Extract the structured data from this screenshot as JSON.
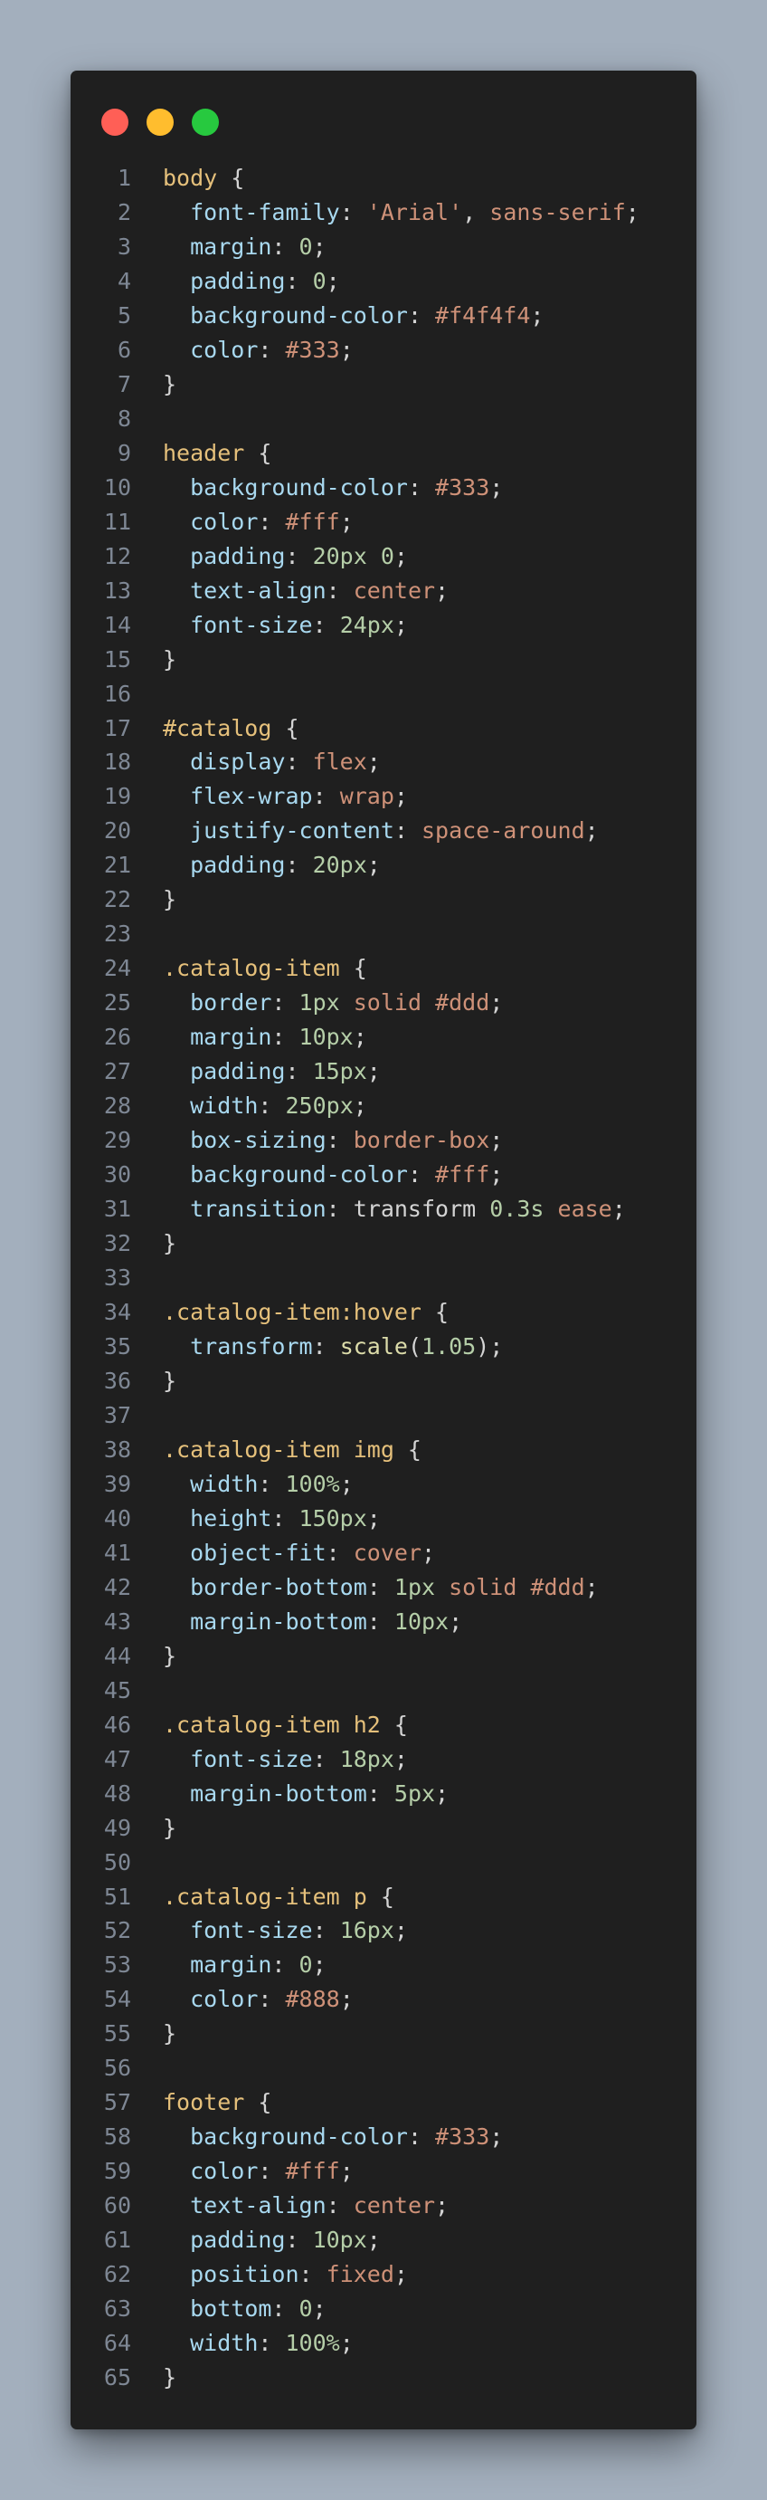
{
  "window": {
    "controls": [
      "close",
      "minimize",
      "maximize"
    ]
  },
  "colors": {
    "background": "#a3afbd",
    "editor_bg": "#1f1f1f",
    "selector": "#e5c07b",
    "property": "#a8d8ef",
    "string": "#ce9178",
    "number": "#b5cea8",
    "keyword": "#ce9178",
    "function": "#dcdcaa",
    "punctuation": "#d4d4d4",
    "line_number": "#7e8794"
  },
  "code": {
    "language": "css",
    "lines": [
      [
        [
          "sel",
          "body"
        ],
        [
          "punc",
          " {"
        ]
      ],
      [
        [
          "punc",
          "  "
        ],
        [
          "prop",
          "font-family"
        ],
        [
          "punc",
          ": "
        ],
        [
          "str",
          "'Arial'"
        ],
        [
          "punc",
          ", "
        ],
        [
          "kw",
          "sans-serif"
        ],
        [
          "punc",
          ";"
        ]
      ],
      [
        [
          "punc",
          "  "
        ],
        [
          "prop",
          "margin"
        ],
        [
          "punc",
          ": "
        ],
        [
          "num",
          "0"
        ],
        [
          "punc",
          ";"
        ]
      ],
      [
        [
          "punc",
          "  "
        ],
        [
          "prop",
          "padding"
        ],
        [
          "punc",
          ": "
        ],
        [
          "num",
          "0"
        ],
        [
          "punc",
          ";"
        ]
      ],
      [
        [
          "punc",
          "  "
        ],
        [
          "prop",
          "background-color"
        ],
        [
          "punc",
          ": "
        ],
        [
          "str",
          "#f4f4f4"
        ],
        [
          "punc",
          ";"
        ]
      ],
      [
        [
          "punc",
          "  "
        ],
        [
          "prop",
          "color"
        ],
        [
          "punc",
          ": "
        ],
        [
          "str",
          "#333"
        ],
        [
          "punc",
          ";"
        ]
      ],
      [
        [
          "punc",
          "}"
        ]
      ],
      [],
      [
        [
          "sel",
          "header"
        ],
        [
          "punc",
          " {"
        ]
      ],
      [
        [
          "punc",
          "  "
        ],
        [
          "prop",
          "background-color"
        ],
        [
          "punc",
          ": "
        ],
        [
          "str",
          "#333"
        ],
        [
          "punc",
          ";"
        ]
      ],
      [
        [
          "punc",
          "  "
        ],
        [
          "prop",
          "color"
        ],
        [
          "punc",
          ": "
        ],
        [
          "str",
          "#fff"
        ],
        [
          "punc",
          ";"
        ]
      ],
      [
        [
          "punc",
          "  "
        ],
        [
          "prop",
          "padding"
        ],
        [
          "punc",
          ": "
        ],
        [
          "num",
          "20px"
        ],
        [
          "punc",
          " "
        ],
        [
          "num",
          "0"
        ],
        [
          "punc",
          ";"
        ]
      ],
      [
        [
          "punc",
          "  "
        ],
        [
          "prop",
          "text-align"
        ],
        [
          "punc",
          ": "
        ],
        [
          "kw",
          "center"
        ],
        [
          "punc",
          ";"
        ]
      ],
      [
        [
          "punc",
          "  "
        ],
        [
          "prop",
          "font-size"
        ],
        [
          "punc",
          ": "
        ],
        [
          "num",
          "24px"
        ],
        [
          "punc",
          ";"
        ]
      ],
      [
        [
          "punc",
          "}"
        ]
      ],
      [],
      [
        [
          "sel",
          "#catalog"
        ],
        [
          "punc",
          " {"
        ]
      ],
      [
        [
          "punc",
          "  "
        ],
        [
          "prop",
          "display"
        ],
        [
          "punc",
          ": "
        ],
        [
          "kw",
          "flex"
        ],
        [
          "punc",
          ";"
        ]
      ],
      [
        [
          "punc",
          "  "
        ],
        [
          "prop",
          "flex-wrap"
        ],
        [
          "punc",
          ": "
        ],
        [
          "kw",
          "wrap"
        ],
        [
          "punc",
          ";"
        ]
      ],
      [
        [
          "punc",
          "  "
        ],
        [
          "prop",
          "justify-content"
        ],
        [
          "punc",
          ": "
        ],
        [
          "kw",
          "space-around"
        ],
        [
          "punc",
          ";"
        ]
      ],
      [
        [
          "punc",
          "  "
        ],
        [
          "prop",
          "padding"
        ],
        [
          "punc",
          ": "
        ],
        [
          "num",
          "20px"
        ],
        [
          "punc",
          ";"
        ]
      ],
      [
        [
          "punc",
          "}"
        ]
      ],
      [],
      [
        [
          "sel",
          ".catalog-item"
        ],
        [
          "punc",
          " {"
        ]
      ],
      [
        [
          "punc",
          "  "
        ],
        [
          "prop",
          "border"
        ],
        [
          "punc",
          ": "
        ],
        [
          "num",
          "1px"
        ],
        [
          "punc",
          " "
        ],
        [
          "kw",
          "solid"
        ],
        [
          "punc",
          " "
        ],
        [
          "str",
          "#ddd"
        ],
        [
          "punc",
          ";"
        ]
      ],
      [
        [
          "punc",
          "  "
        ],
        [
          "prop",
          "margin"
        ],
        [
          "punc",
          ": "
        ],
        [
          "num",
          "10px"
        ],
        [
          "punc",
          ";"
        ]
      ],
      [
        [
          "punc",
          "  "
        ],
        [
          "prop",
          "padding"
        ],
        [
          "punc",
          ": "
        ],
        [
          "num",
          "15px"
        ],
        [
          "punc",
          ";"
        ]
      ],
      [
        [
          "punc",
          "  "
        ],
        [
          "prop",
          "width"
        ],
        [
          "punc",
          ": "
        ],
        [
          "num",
          "250px"
        ],
        [
          "punc",
          ";"
        ]
      ],
      [
        [
          "punc",
          "  "
        ],
        [
          "prop",
          "box-sizing"
        ],
        [
          "punc",
          ": "
        ],
        [
          "kw",
          "border-box"
        ],
        [
          "punc",
          ";"
        ]
      ],
      [
        [
          "punc",
          "  "
        ],
        [
          "prop",
          "background-color"
        ],
        [
          "punc",
          ": "
        ],
        [
          "str",
          "#fff"
        ],
        [
          "punc",
          ";"
        ]
      ],
      [
        [
          "punc",
          "  "
        ],
        [
          "prop",
          "transition"
        ],
        [
          "punc",
          ": transform "
        ],
        [
          "num",
          "0.3s"
        ],
        [
          "punc",
          " "
        ],
        [
          "kw",
          "ease"
        ],
        [
          "punc",
          ";"
        ]
      ],
      [
        [
          "punc",
          "}"
        ]
      ],
      [],
      [
        [
          "sel",
          ".catalog-item:hover"
        ],
        [
          "punc",
          " {"
        ]
      ],
      [
        [
          "punc",
          "  "
        ],
        [
          "prop",
          "transform"
        ],
        [
          "punc",
          ": "
        ],
        [
          "fn",
          "scale"
        ],
        [
          "punc",
          "("
        ],
        [
          "num",
          "1.05"
        ],
        [
          "punc",
          ");"
        ]
      ],
      [
        [
          "punc",
          "}"
        ]
      ],
      [],
      [
        [
          "sel",
          ".catalog-item img"
        ],
        [
          "punc",
          " {"
        ]
      ],
      [
        [
          "punc",
          "  "
        ],
        [
          "prop",
          "width"
        ],
        [
          "punc",
          ": "
        ],
        [
          "num",
          "100%"
        ],
        [
          "punc",
          ";"
        ]
      ],
      [
        [
          "punc",
          "  "
        ],
        [
          "prop",
          "height"
        ],
        [
          "punc",
          ": "
        ],
        [
          "num",
          "150px"
        ],
        [
          "punc",
          ";"
        ]
      ],
      [
        [
          "punc",
          "  "
        ],
        [
          "prop",
          "object-fit"
        ],
        [
          "punc",
          ": "
        ],
        [
          "kw",
          "cover"
        ],
        [
          "punc",
          ";"
        ]
      ],
      [
        [
          "punc",
          "  "
        ],
        [
          "prop",
          "border-bottom"
        ],
        [
          "punc",
          ": "
        ],
        [
          "num",
          "1px"
        ],
        [
          "punc",
          " "
        ],
        [
          "kw",
          "solid"
        ],
        [
          "punc",
          " "
        ],
        [
          "str",
          "#ddd"
        ],
        [
          "punc",
          ";"
        ]
      ],
      [
        [
          "punc",
          "  "
        ],
        [
          "prop",
          "margin-bottom"
        ],
        [
          "punc",
          ": "
        ],
        [
          "num",
          "10px"
        ],
        [
          "punc",
          ";"
        ]
      ],
      [
        [
          "punc",
          "}"
        ]
      ],
      [],
      [
        [
          "sel",
          ".catalog-item h2"
        ],
        [
          "punc",
          " {"
        ]
      ],
      [
        [
          "punc",
          "  "
        ],
        [
          "prop",
          "font-size"
        ],
        [
          "punc",
          ": "
        ],
        [
          "num",
          "18px"
        ],
        [
          "punc",
          ";"
        ]
      ],
      [
        [
          "punc",
          "  "
        ],
        [
          "prop",
          "margin-bottom"
        ],
        [
          "punc",
          ": "
        ],
        [
          "num",
          "5px"
        ],
        [
          "punc",
          ";"
        ]
      ],
      [
        [
          "punc",
          "}"
        ]
      ],
      [],
      [
        [
          "sel",
          ".catalog-item p"
        ],
        [
          "punc",
          " {"
        ]
      ],
      [
        [
          "punc",
          "  "
        ],
        [
          "prop",
          "font-size"
        ],
        [
          "punc",
          ": "
        ],
        [
          "num",
          "16px"
        ],
        [
          "punc",
          ";"
        ]
      ],
      [
        [
          "punc",
          "  "
        ],
        [
          "prop",
          "margin"
        ],
        [
          "punc",
          ": "
        ],
        [
          "num",
          "0"
        ],
        [
          "punc",
          ";"
        ]
      ],
      [
        [
          "punc",
          "  "
        ],
        [
          "prop",
          "color"
        ],
        [
          "punc",
          ": "
        ],
        [
          "str",
          "#888"
        ],
        [
          "punc",
          ";"
        ]
      ],
      [
        [
          "punc",
          "}"
        ]
      ],
      [],
      [
        [
          "sel",
          "footer"
        ],
        [
          "punc",
          " {"
        ]
      ],
      [
        [
          "punc",
          "  "
        ],
        [
          "prop",
          "background-color"
        ],
        [
          "punc",
          ": "
        ],
        [
          "str",
          "#333"
        ],
        [
          "punc",
          ";"
        ]
      ],
      [
        [
          "punc",
          "  "
        ],
        [
          "prop",
          "color"
        ],
        [
          "punc",
          ": "
        ],
        [
          "str",
          "#fff"
        ],
        [
          "punc",
          ";"
        ]
      ],
      [
        [
          "punc",
          "  "
        ],
        [
          "prop",
          "text-align"
        ],
        [
          "punc",
          ": "
        ],
        [
          "kw",
          "center"
        ],
        [
          "punc",
          ";"
        ]
      ],
      [
        [
          "punc",
          "  "
        ],
        [
          "prop",
          "padding"
        ],
        [
          "punc",
          ": "
        ],
        [
          "num",
          "10px"
        ],
        [
          "punc",
          ";"
        ]
      ],
      [
        [
          "punc",
          "  "
        ],
        [
          "prop",
          "position"
        ],
        [
          "punc",
          ": "
        ],
        [
          "kw",
          "fixed"
        ],
        [
          "punc",
          ";"
        ]
      ],
      [
        [
          "punc",
          "  "
        ],
        [
          "prop",
          "bottom"
        ],
        [
          "punc",
          ": "
        ],
        [
          "num",
          "0"
        ],
        [
          "punc",
          ";"
        ]
      ],
      [
        [
          "punc",
          "  "
        ],
        [
          "prop",
          "width"
        ],
        [
          "punc",
          ": "
        ],
        [
          "num",
          "100%"
        ],
        [
          "punc",
          ";"
        ]
      ],
      [
        [
          "punc",
          "}"
        ]
      ]
    ]
  }
}
